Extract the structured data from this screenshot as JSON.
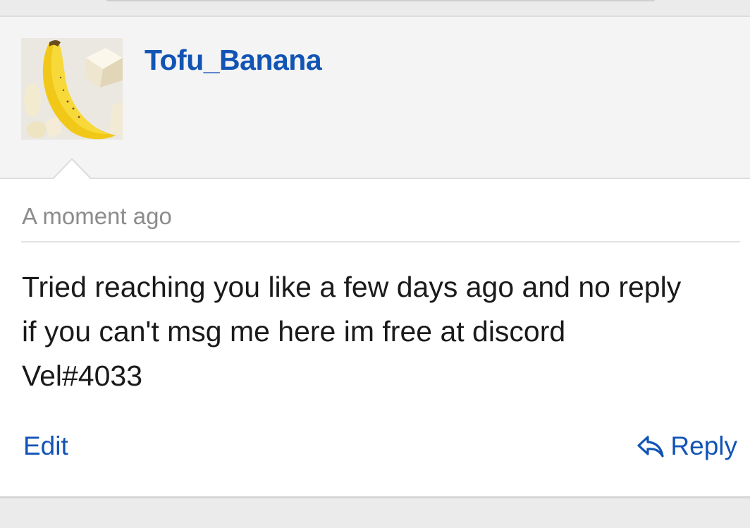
{
  "post": {
    "author": {
      "username": "Tofu_Banana",
      "avatar_icon": "tofu-banana-avatar"
    },
    "timestamp": "A moment ago",
    "message_lines": [
      "Tried reaching you like a few days ago and no reply",
      "if you can't msg me here im free at discord",
      "Vel#4033"
    ],
    "actions": {
      "edit_label": "Edit",
      "reply_label": "Reply",
      "reply_icon": "reply-arrow-icon"
    }
  },
  "colors": {
    "link": "#1254b4",
    "timestamp": "#8c8c8c",
    "text": "#1a1a1a",
    "author_background": "#f4f4f4"
  }
}
